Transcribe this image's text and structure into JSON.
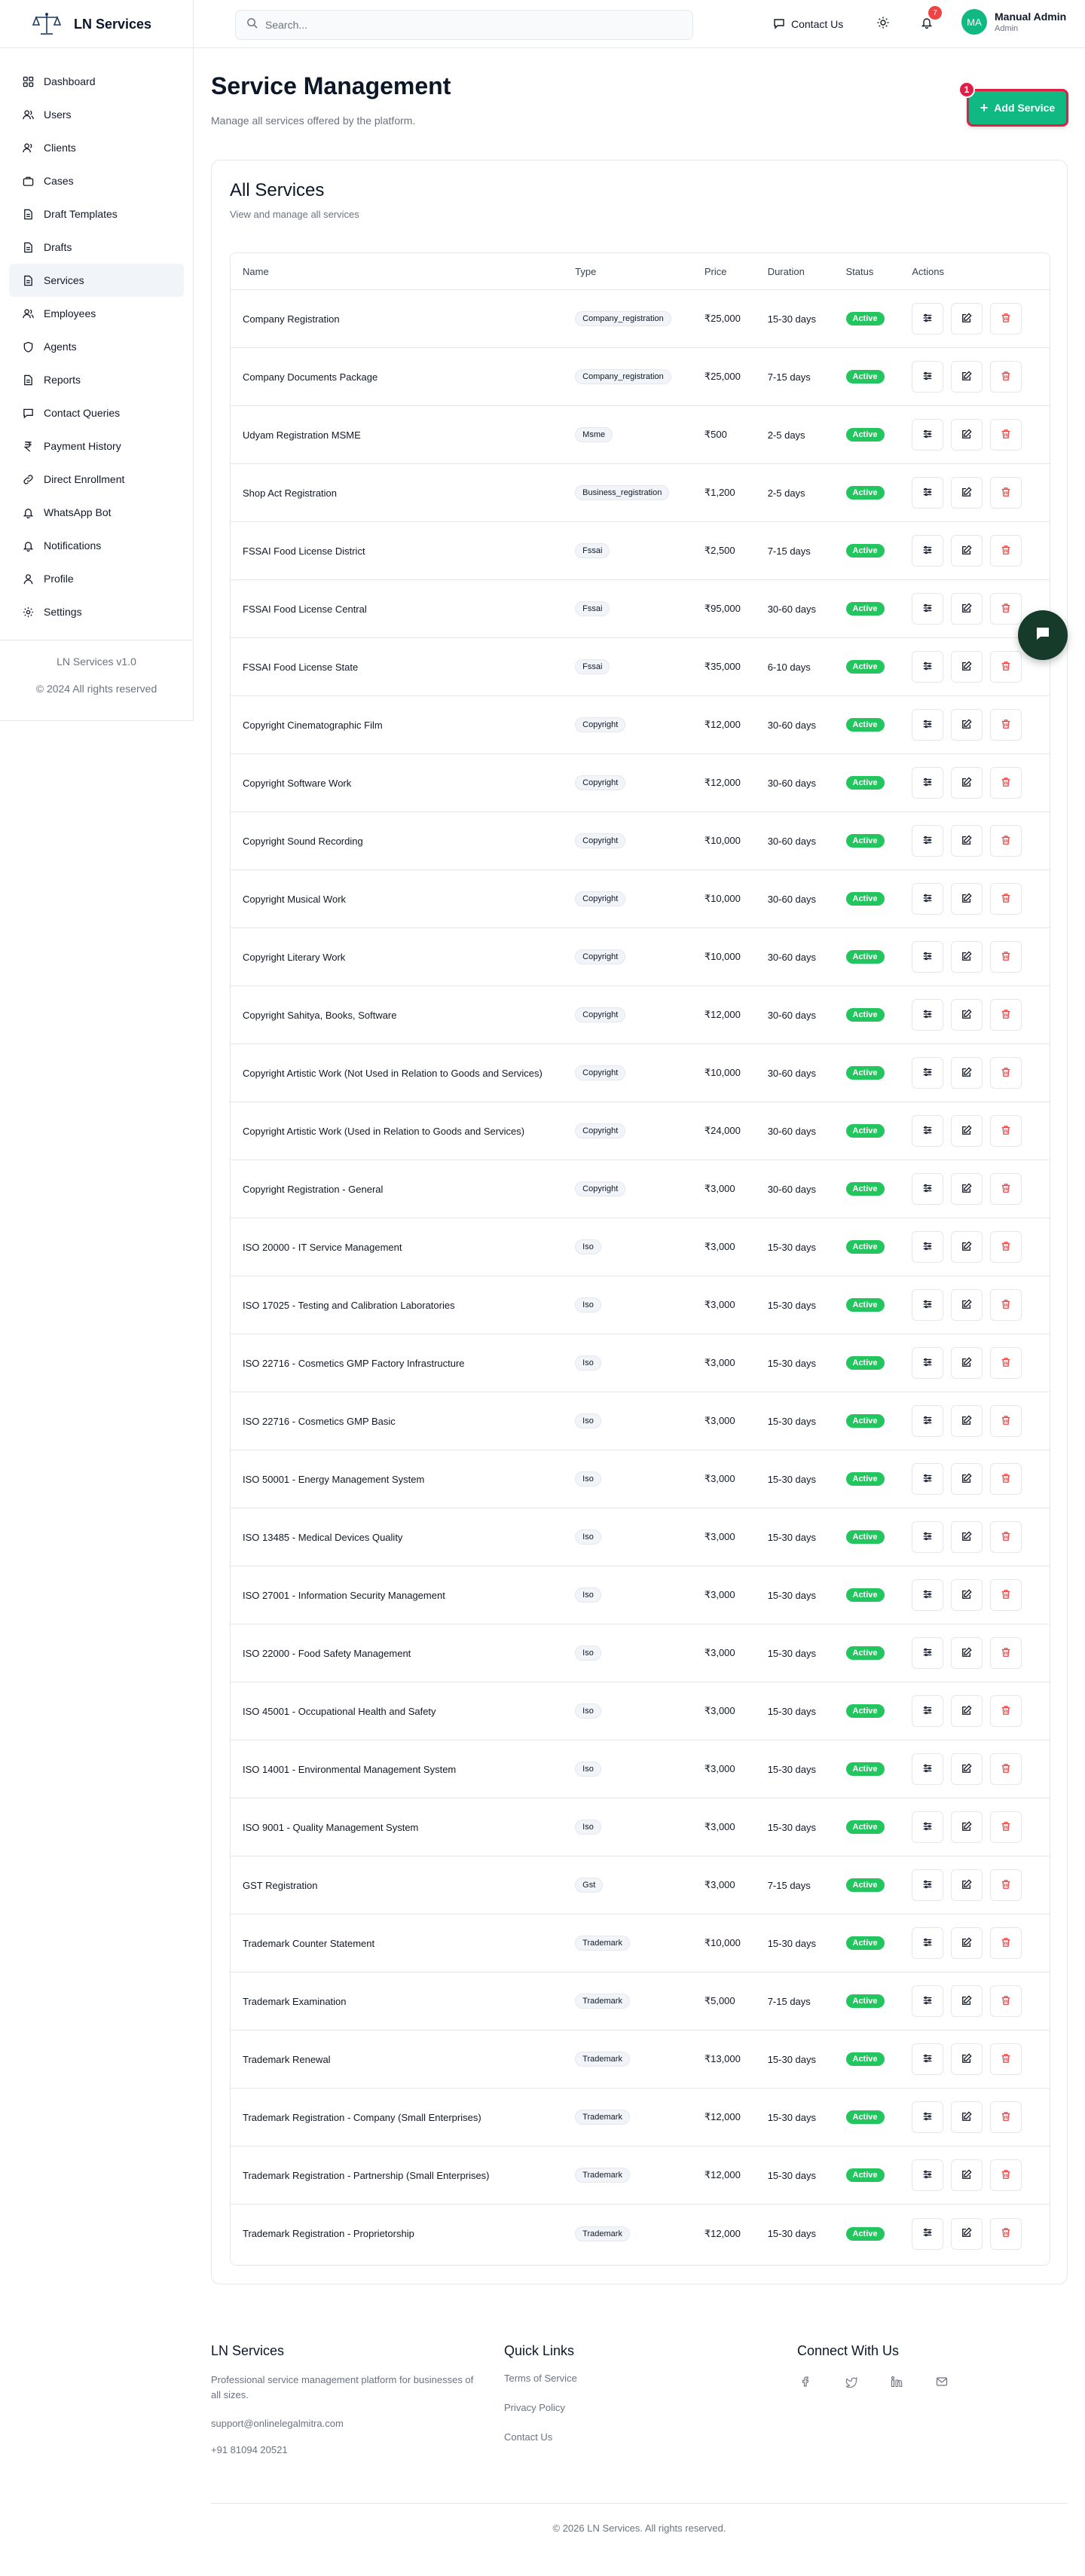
{
  "brand": {
    "name": "LN Services"
  },
  "header": {
    "search_placeholder": "Search...",
    "contact_label": "Contact Us",
    "notification_count": "7",
    "user": {
      "initials": "MA",
      "name": "Manual Admin",
      "role": "Admin"
    }
  },
  "sidebar": {
    "items": [
      {
        "label": "Dashboard",
        "icon": "dashboard-icon"
      },
      {
        "label": "Users",
        "icon": "users-icon"
      },
      {
        "label": "Clients",
        "icon": "clients-icon"
      },
      {
        "label": "Cases",
        "icon": "briefcase-icon"
      },
      {
        "label": "Draft Templates",
        "icon": "file-icon"
      },
      {
        "label": "Drafts",
        "icon": "file-icon"
      },
      {
        "label": "Services",
        "icon": "file-icon",
        "active": true
      },
      {
        "label": "Employees",
        "icon": "users-icon"
      },
      {
        "label": "Agents",
        "icon": "shield-icon"
      },
      {
        "label": "Reports",
        "icon": "file-icon"
      },
      {
        "label": "Contact Queries",
        "icon": "message-icon"
      },
      {
        "label": "Payment History",
        "icon": "rupee-icon"
      },
      {
        "label": "Direct Enrollment",
        "icon": "link-icon"
      },
      {
        "label": "WhatsApp Bot",
        "icon": "bell-icon"
      },
      {
        "label": "Notifications",
        "icon": "bell-icon"
      },
      {
        "label": "Profile",
        "icon": "user-icon"
      },
      {
        "label": "Settings",
        "icon": "gear-icon"
      }
    ],
    "version": "LN Services v1.0",
    "copyright": "© 2024 All rights reserved"
  },
  "page": {
    "title": "Service Management",
    "subtitle": "Manage all services offered by the platform.",
    "add_button": "Add Service",
    "add_badge": "1"
  },
  "card": {
    "title": "All Services",
    "subtitle": "View and manage all services"
  },
  "table": {
    "headers": [
      "Name",
      "Type",
      "Price",
      "Duration",
      "Status",
      "Actions"
    ],
    "rows": [
      {
        "name": "Company Registration",
        "type": "Company_registration",
        "price": "₹25,000",
        "duration": "15-30 days",
        "status": "Active"
      },
      {
        "name": "Company Documents Package",
        "type": "Company_registration",
        "price": "₹25,000",
        "duration": "7-15 days",
        "status": "Active"
      },
      {
        "name": "Udyam Registration MSME",
        "type": "Msme",
        "price": "₹500",
        "duration": "2-5 days",
        "status": "Active"
      },
      {
        "name": "Shop Act Registration",
        "type": "Business_registration",
        "price": "₹1,200",
        "duration": "2-5 days",
        "status": "Active"
      },
      {
        "name": "FSSAI Food License District",
        "type": "Fssai",
        "price": "₹2,500",
        "duration": "7-15 days",
        "status": "Active"
      },
      {
        "name": "FSSAI Food License Central",
        "type": "Fssai",
        "price": "₹95,000",
        "duration": "30-60 days",
        "status": "Active"
      },
      {
        "name": "FSSAI Food License State",
        "type": "Fssai",
        "price": "₹35,000",
        "duration": "6-10 days",
        "status": "Active"
      },
      {
        "name": "Copyright Cinematographic Film",
        "type": "Copyright",
        "price": "₹12,000",
        "duration": "30-60 days",
        "status": "Active"
      },
      {
        "name": "Copyright Software Work",
        "type": "Copyright",
        "price": "₹12,000",
        "duration": "30-60 days",
        "status": "Active"
      },
      {
        "name": "Copyright Sound Recording",
        "type": "Copyright",
        "price": "₹10,000",
        "duration": "30-60 days",
        "status": "Active"
      },
      {
        "name": "Copyright Musical Work",
        "type": "Copyright",
        "price": "₹10,000",
        "duration": "30-60 days",
        "status": "Active"
      },
      {
        "name": "Copyright Literary Work",
        "type": "Copyright",
        "price": "₹10,000",
        "duration": "30-60 days",
        "status": "Active"
      },
      {
        "name": "Copyright Sahitya, Books, Software",
        "type": "Copyright",
        "price": "₹12,000",
        "duration": "30-60 days",
        "status": "Active"
      },
      {
        "name": "Copyright Artistic Work (Not Used in Relation to Goods and Services)",
        "type": "Copyright",
        "price": "₹10,000",
        "duration": "30-60 days",
        "status": "Active"
      },
      {
        "name": "Copyright Artistic Work (Used in Relation to Goods and Services)",
        "type": "Copyright",
        "price": "₹24,000",
        "duration": "30-60 days",
        "status": "Active"
      },
      {
        "name": "Copyright Registration - General",
        "type": "Copyright",
        "price": "₹3,000",
        "duration": "30-60 days",
        "status": "Active"
      },
      {
        "name": "ISO 20000 - IT Service Management",
        "type": "Iso",
        "price": "₹3,000",
        "duration": "15-30 days",
        "status": "Active"
      },
      {
        "name": "ISO 17025 - Testing and Calibration Laboratories",
        "type": "Iso",
        "price": "₹3,000",
        "duration": "15-30 days",
        "status": "Active"
      },
      {
        "name": "ISO 22716 - Cosmetics GMP Factory Infrastructure",
        "type": "Iso",
        "price": "₹3,000",
        "duration": "15-30 days",
        "status": "Active"
      },
      {
        "name": "ISO 22716 - Cosmetics GMP Basic",
        "type": "Iso",
        "price": "₹3,000",
        "duration": "15-30 days",
        "status": "Active"
      },
      {
        "name": "ISO 50001 - Energy Management System",
        "type": "Iso",
        "price": "₹3,000",
        "duration": "15-30 days",
        "status": "Active"
      },
      {
        "name": "ISO 13485 - Medical Devices Quality",
        "type": "Iso",
        "price": "₹3,000",
        "duration": "15-30 days",
        "status": "Active"
      },
      {
        "name": "ISO 27001 - Information Security Management",
        "type": "Iso",
        "price": "₹3,000",
        "duration": "15-30 days",
        "status": "Active"
      },
      {
        "name": "ISO 22000 - Food Safety Management",
        "type": "Iso",
        "price": "₹3,000",
        "duration": "15-30 days",
        "status": "Active"
      },
      {
        "name": "ISO 45001 - Occupational Health and Safety",
        "type": "Iso",
        "price": "₹3,000",
        "duration": "15-30 days",
        "status": "Active"
      },
      {
        "name": "ISO 14001 - Environmental Management System",
        "type": "Iso",
        "price": "₹3,000",
        "duration": "15-30 days",
        "status": "Active"
      },
      {
        "name": "ISO 9001 - Quality Management System",
        "type": "Iso",
        "price": "₹3,000",
        "duration": "15-30 days",
        "status": "Active"
      },
      {
        "name": "GST Registration",
        "type": "Gst",
        "price": "₹3,000",
        "duration": "7-15 days",
        "status": "Active"
      },
      {
        "name": "Trademark Counter Statement",
        "type": "Trademark",
        "price": "₹10,000",
        "duration": "15-30 days",
        "status": "Active"
      },
      {
        "name": "Trademark Examination",
        "type": "Trademark",
        "price": "₹5,000",
        "duration": "7-15 days",
        "status": "Active"
      },
      {
        "name": "Trademark Renewal",
        "type": "Trademark",
        "price": "₹13,000",
        "duration": "15-30 days",
        "status": "Active"
      },
      {
        "name": "Trademark Registration - Company (Small Enterprises)",
        "type": "Trademark",
        "price": "₹12,000",
        "duration": "15-30 days",
        "status": "Active"
      },
      {
        "name": "Trademark Registration - Partnership (Small Enterprises)",
        "type": "Trademark",
        "price": "₹12,000",
        "duration": "15-30 days",
        "status": "Active"
      },
      {
        "name": "Trademark Registration - Proprietorship",
        "type": "Trademark",
        "price": "₹12,000",
        "duration": "15-30 days",
        "status": "Active"
      }
    ]
  },
  "footer": {
    "brand": "LN Services",
    "description": "Professional service management platform for businesses of all sizes.",
    "email": "support@onlinelegalmitra.com",
    "phone": "+91 81094 20521",
    "quick_links_title": "Quick Links",
    "links": [
      "Terms of Service",
      "Privacy Policy",
      "Contact Us"
    ],
    "connect_title": "Connect With Us",
    "social": [
      "facebook-icon",
      "twitter-icon",
      "linkedin-icon",
      "mail-icon"
    ],
    "copyright": "© 2026 LN Services. All rights reserved."
  },
  "colors": {
    "accent": "#10b981",
    "status_active": "#22c55e",
    "highlight": "#e11d48",
    "delete": "#ef4444",
    "chat_fab": "#163b2a"
  }
}
